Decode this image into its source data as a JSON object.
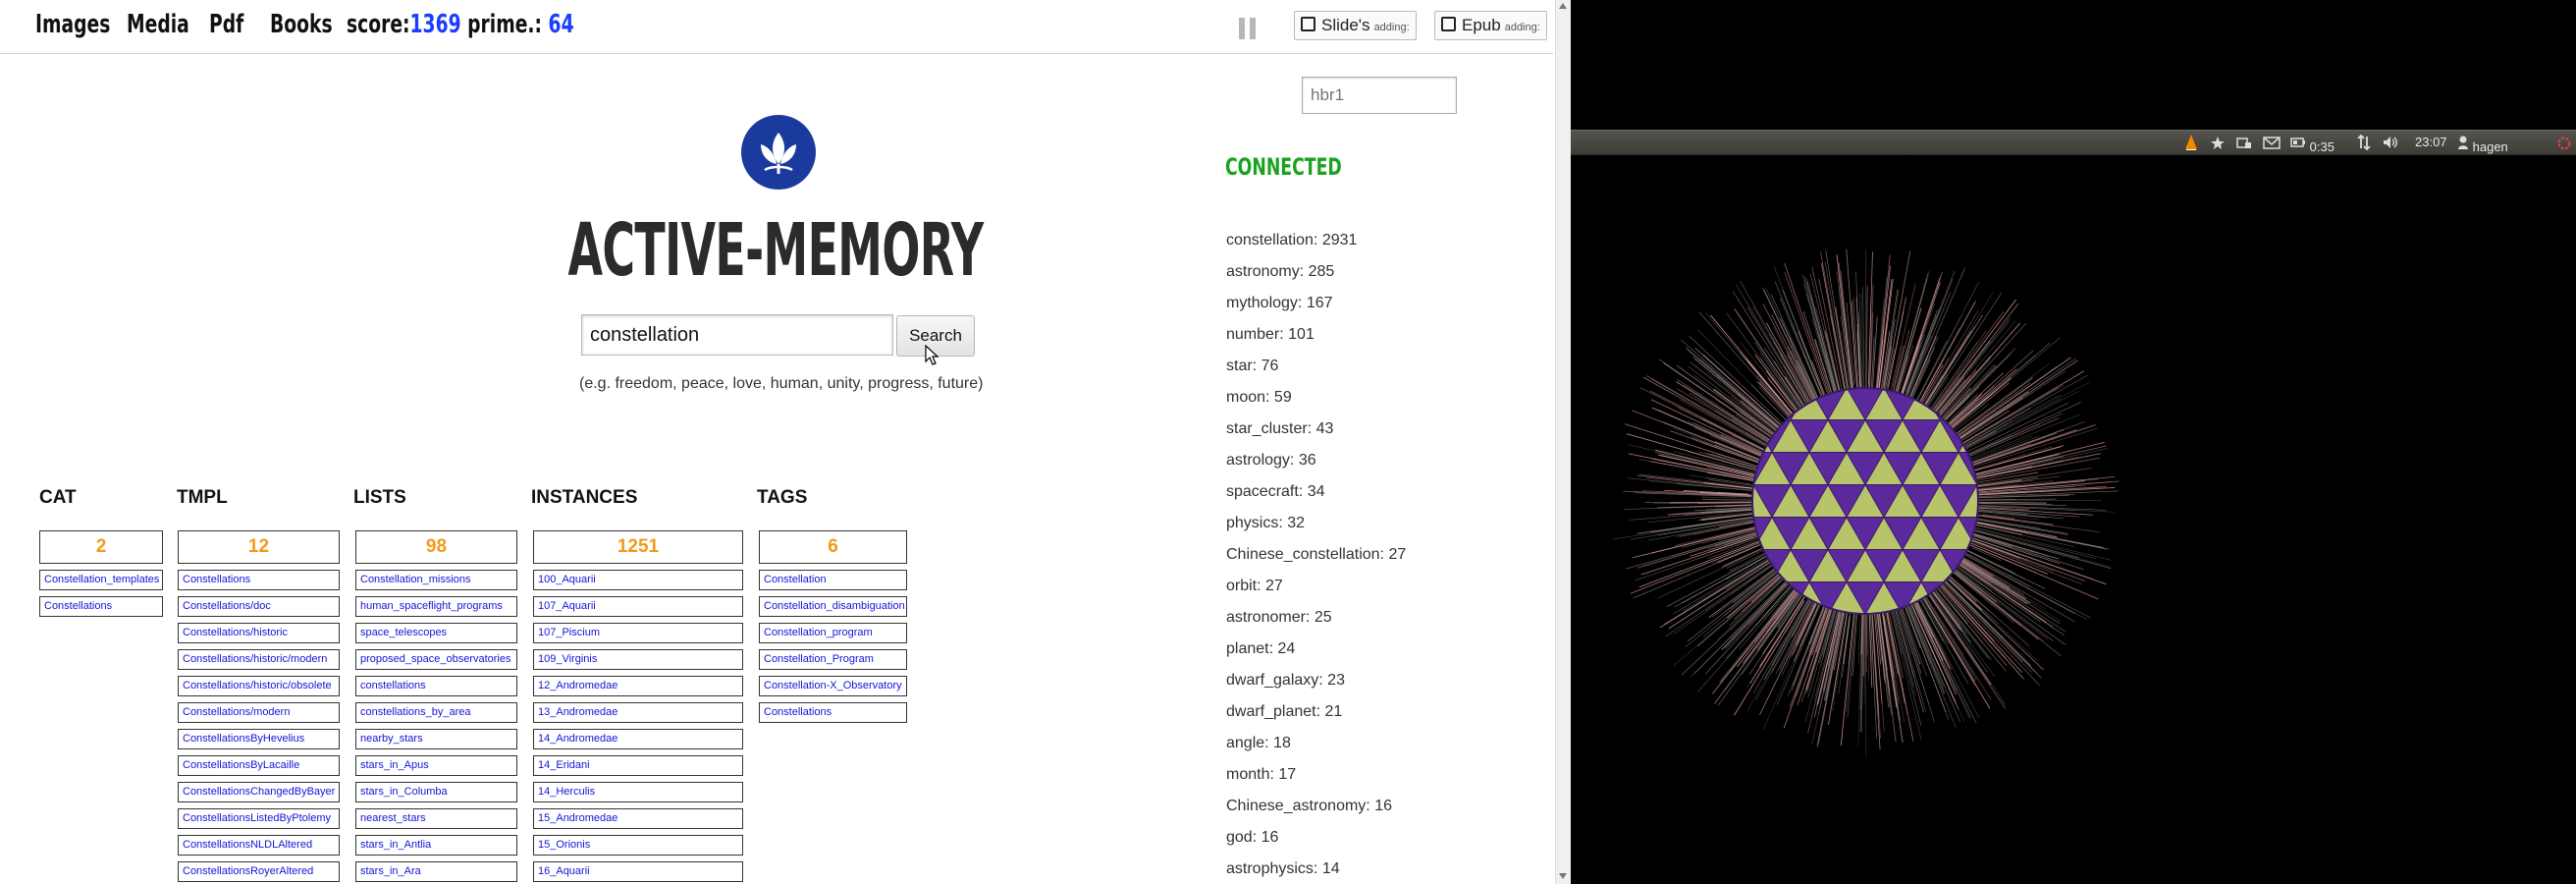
{
  "nav": {
    "links": [
      "Images",
      "Media",
      "Pdf",
      "Books"
    ],
    "score_label": "score:",
    "score_value": "1369",
    "prime_label": "prime.:",
    "prime_value": "64"
  },
  "addbuttons": {
    "slides_label": "Slide's",
    "slides_small": "adding:",
    "epub_label": "Epub",
    "epub_small": "adding:"
  },
  "hbr_placeholder": "hbr1",
  "app_title": "ACTIVE-MEMORY",
  "search": {
    "value": "constellation",
    "button": "Search",
    "hint": "(e.g. freedom, peace, love, human, unity, progress, future)"
  },
  "status": "CONNECTED",
  "columns": [
    {
      "head": "CAT",
      "count": "2",
      "items": [
        "Constellation_templates",
        "Constellations"
      ]
    },
    {
      "head": "TMPL",
      "count": "12",
      "items": [
        "Constellations",
        "Constellations/doc",
        "Constellations/historic",
        "Constellations/historic/modern",
        "Constellations/historic/obsolete",
        "Constellations/modern",
        "ConstellationsByHevelius",
        "ConstellationsByLacaille",
        "ConstellationsChangedByBayer",
        "ConstellationsListedByPtolemy",
        "ConstellationsNLDLAltered",
        "ConstellationsRoyerAltered"
      ]
    },
    {
      "head": "LISTS",
      "count": "98",
      "items": [
        "Constellation_missions",
        "human_spaceflight_programs",
        "space_telescopes",
        "proposed_space_observatories",
        "constellations",
        "constellations_by_area",
        "nearby_stars",
        "stars_in_Apus",
        "stars_in_Columba",
        "nearest_stars",
        "stars_in_Antlia",
        "stars_in_Ara"
      ]
    },
    {
      "head": "INSTANCES",
      "count": "1251",
      "items": [
        "100_Aquarii",
        "107_Aquarii",
        "107_Piscium",
        "109_Virginis",
        "12_Andromedae",
        "13_Andromedae",
        "14_Andromedae",
        "14_Eridani",
        "14_Herculis",
        "15_Andromedae",
        "15_Orionis",
        "16_Aquarii"
      ]
    },
    {
      "head": "TAGS",
      "count": "6",
      "items": [
        "Constellation",
        "Constellation_disambiguation",
        "Constellation_program",
        "Constellation_Program",
        "Constellation-X_Observatory",
        "Constellations"
      ]
    }
  ],
  "frequencies": [
    "constellation: 2931",
    "astronomy: 285",
    "mythology: 167",
    "number: 101",
    "star: 76",
    "moon: 59",
    "star_cluster: 43",
    "astrology: 36",
    "spacecraft: 34",
    "physics: 32",
    "Chinese_constellation: 27",
    "orbit: 27",
    "astronomer: 25",
    "planet: 24",
    "dwarf_galaxy: 23",
    "dwarf_planet: 21",
    "angle: 18",
    "month: 17",
    "Chinese_astronomy: 16",
    "god: 16",
    "astrophysics: 14"
  ],
  "panel": {
    "battery": "0:35",
    "time": "23:07",
    "user": "hagen"
  },
  "colors": {
    "accent_blue": "#1a3dff",
    "count_orange": "#f39a1c",
    "link_blue": "#1414d6",
    "connected_green": "#1aa321",
    "logo_blue": "#1b3a9e",
    "sphere_purple": "#5a2a9c",
    "sphere_yellow": "#b8c46a"
  },
  "icons": [
    "pause-icon",
    "lotus-logo-icon",
    "vlc-icon",
    "network-icon",
    "mail-icon",
    "battery-icon",
    "transfer-icon",
    "volume-icon",
    "user-icon",
    "power-icon"
  ]
}
